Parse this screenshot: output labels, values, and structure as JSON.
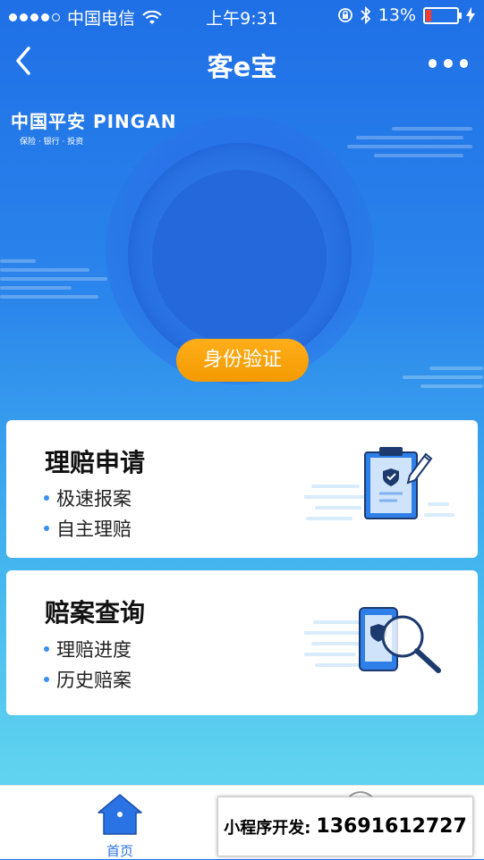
{
  "status_bar": {
    "carrier": "中国电信",
    "time": "上午9:31",
    "battery_percent": "13%",
    "icons": [
      "signal-dots-icon",
      "wifi-icon",
      "rotation-lock-icon",
      "bluetooth-icon",
      "battery-icon",
      "charging-icon"
    ]
  },
  "nav": {
    "title": "客e宝",
    "back_icon": "chevron-left-icon",
    "more_icon": "more-dots-icon"
  },
  "logo": {
    "text": "中国平安 PINGAN",
    "tagline": "保险 · 银行 · 投资"
  },
  "verify_button": {
    "label": "身份验证",
    "color": "#f7a30c"
  },
  "cards": [
    {
      "title": "理赔申请",
      "items": [
        "极速报案",
        "自主理赔"
      ],
      "illustration": "clipboard-pencil-icon"
    },
    {
      "title": "赔案查询",
      "items": [
        "理赔进度",
        "历史赔案"
      ],
      "illustration": "phone-magnifier-icon"
    }
  ],
  "tab_bar": {
    "home_label": "首页",
    "home_icon": "home-icon",
    "accent": "#2a73e4"
  },
  "promo": {
    "label": "小程序开发:",
    "phone": "13691612727"
  }
}
